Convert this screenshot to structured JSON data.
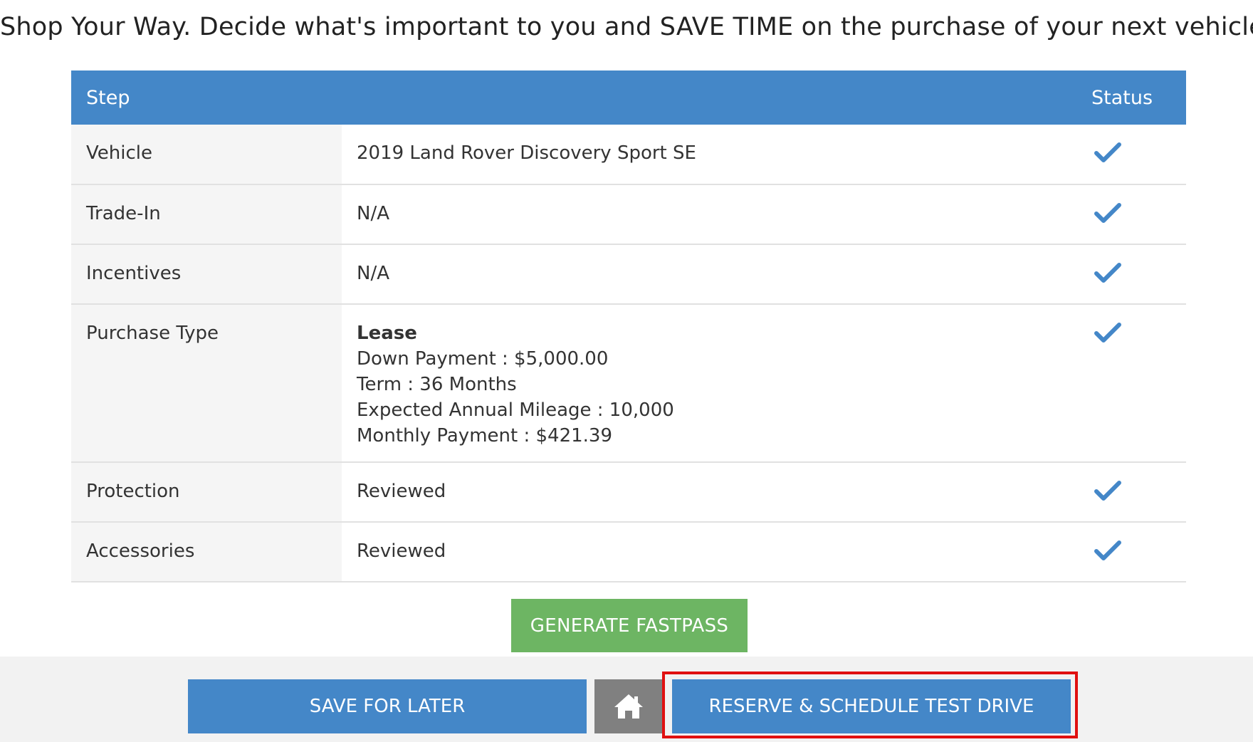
{
  "headline": "Shop Your Way. Decide what's important to you and SAVE TIME on the purchase of your next vehicle.",
  "table": {
    "headers": {
      "step": "Step",
      "status": "Status"
    },
    "rows": [
      {
        "step": "Vehicle",
        "value": "2019 Land Rover Discovery Sport SE",
        "status": "check-icon"
      },
      {
        "step": "Trade-In",
        "value": "N/A",
        "status": "check-icon"
      },
      {
        "step": "Incentives",
        "value": "N/A",
        "status": "check-icon"
      },
      {
        "step": "Purchase Type",
        "value": "Lease",
        "details": [
          "Down Payment : $5,000.00",
          "Term : 36 Months",
          "Expected Annual Mileage : 10,000",
          "Monthly Payment : $421.39"
        ],
        "status": "check-icon"
      },
      {
        "step": "Protection",
        "value": "Reviewed",
        "status": "check-icon"
      },
      {
        "step": "Accessories",
        "value": "Reviewed",
        "status": "check-icon"
      }
    ]
  },
  "buttons": {
    "generate_fastpass": "GENERATE FASTPASS",
    "save_for_later": "SAVE FOR LATER",
    "home_icon": "home-icon",
    "reserve": "RESERVE & SCHEDULE TEST DRIVE"
  },
  "colors": {
    "header_blue": "#4487c8",
    "check_blue": "#4487c8",
    "fastpass_green": "#6db563",
    "home_gray": "#808080",
    "highlight_red": "#e01010"
  }
}
